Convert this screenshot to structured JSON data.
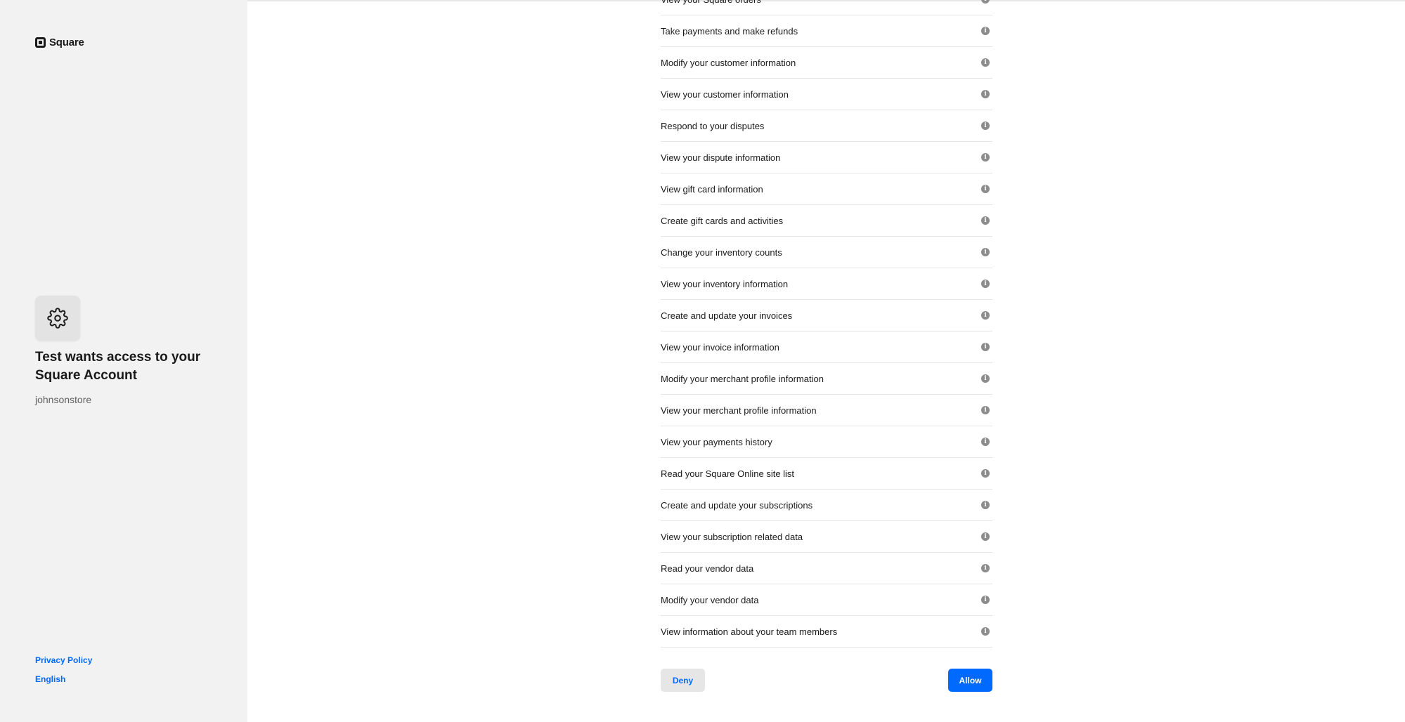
{
  "brand": {
    "name": "Square",
    "icon": "square-logo-icon"
  },
  "app": {
    "icon": "gear-icon",
    "headline": "Test wants access to your Square Account",
    "account": "johnsonstore"
  },
  "footer": {
    "privacy": "Privacy Policy",
    "language": "English"
  },
  "permissions": [
    "View your Square orders",
    "Take payments and make refunds",
    "Modify your customer information",
    "View your customer information",
    "Respond to your disputes",
    "View your dispute information",
    "View gift card information",
    "Create gift cards and activities",
    "Change your inventory counts",
    "View your inventory information",
    "Create and update your invoices",
    "View your invoice information",
    "Modify your merchant profile information",
    "View your merchant profile information",
    "View your payments history",
    "Read your Square Online site list",
    "Create and update your subscriptions",
    "View your subscription related data",
    "Read your vendor data",
    "Modify your vendor data",
    "View information about your team members"
  ],
  "info_icon_glyph": "i",
  "actions": {
    "deny": "Deny",
    "allow": "Allow"
  },
  "colors": {
    "accent": "#006aff",
    "sidebar": "#f2f2f2"
  }
}
